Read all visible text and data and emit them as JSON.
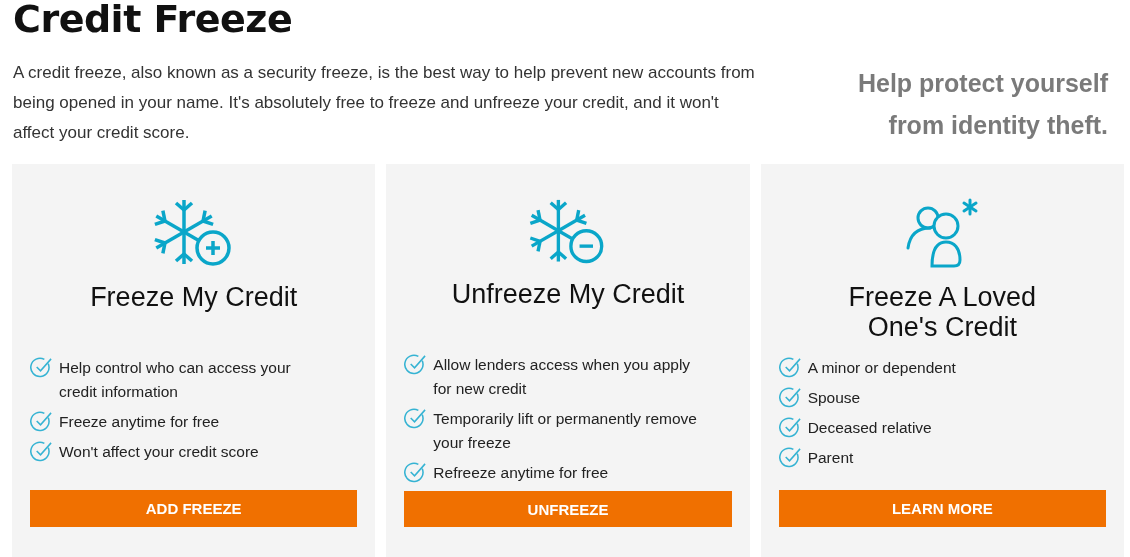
{
  "title": "Credit Freeze",
  "intro": "A credit freeze, also known as a security freeze, is the best way to help prevent new accounts from being opened in your name. It's absolutely free to freeze and unfreeze your credit, and it won't affect your credit score.",
  "tagline": "Help protect yourself from identity theft.",
  "cards": [
    {
      "kind": "freeze",
      "title": "Freeze My Credit",
      "items": [
        "Help control who can access your credit information",
        "Freeze anytime for free",
        "Won't affect your credit score"
      ],
      "button": "ADD FREEZE"
    },
    {
      "kind": "unfreeze",
      "title": "Unfreeze My Credit",
      "items": [
        "Allow lenders access when you apply for new credit",
        "Temporarily lift or permanently remove your freeze",
        "Refreeze anytime for free"
      ],
      "button": "UNFREEZE"
    },
    {
      "kind": "loved-one",
      "title": "Freeze A Loved One's Credit",
      "items": [
        "A minor or dependent",
        "Spouse",
        "Deceased relative",
        "Parent"
      ],
      "button": "LEARN MORE"
    }
  ]
}
